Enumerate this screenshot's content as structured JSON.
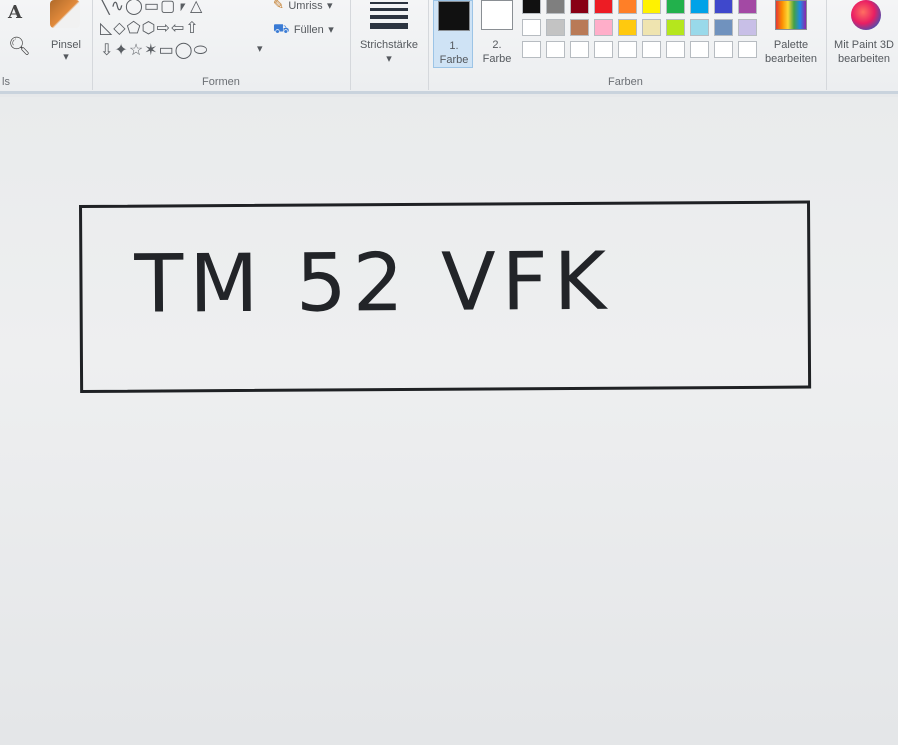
{
  "ribbon": {
    "tools_label_partial": "ls",
    "brush_label": "Pinsel",
    "shapes_group_label": "Formen",
    "outline_label": "Umriss",
    "fill_label": "Füllen",
    "stroke_label": "Strichstärke",
    "color1_label_line1": "1.",
    "color1_label_line2": "Farbe",
    "color2_label_line1": "2.",
    "color2_label_line2": "Farbe",
    "colors_group_label": "Farben",
    "edit_palette_line1": "Palette",
    "edit_palette_line2": "bearbeiten",
    "paint3d_line1": "Mit Paint 3D",
    "paint3d_line2": "bearbeiten",
    "color1_value": "#111111",
    "color2_value": "#ffffff",
    "palette_rows": [
      [
        "#111111",
        "#7f7f7f",
        "#880015",
        "#ed1c24",
        "#ff7f27",
        "#fff200",
        "#22b14c",
        "#00a2e8",
        "#3f48cc",
        "#a349a4"
      ],
      [
        "#ffffff",
        "#c3c3c3",
        "#b97a57",
        "#ffaec9",
        "#ffc90e",
        "#efe4b0",
        "#b5e61d",
        "#99d9ea",
        "#7092be",
        "#c8bfe7"
      ],
      [
        "#ffffff",
        "#ffffff",
        "#ffffff",
        "#ffffff",
        "#ffffff",
        "#ffffff",
        "#ffffff",
        "#ffffff",
        "#ffffff",
        "#ffffff"
      ]
    ]
  },
  "canvas": {
    "plate_text": "TM 52 VFK"
  }
}
